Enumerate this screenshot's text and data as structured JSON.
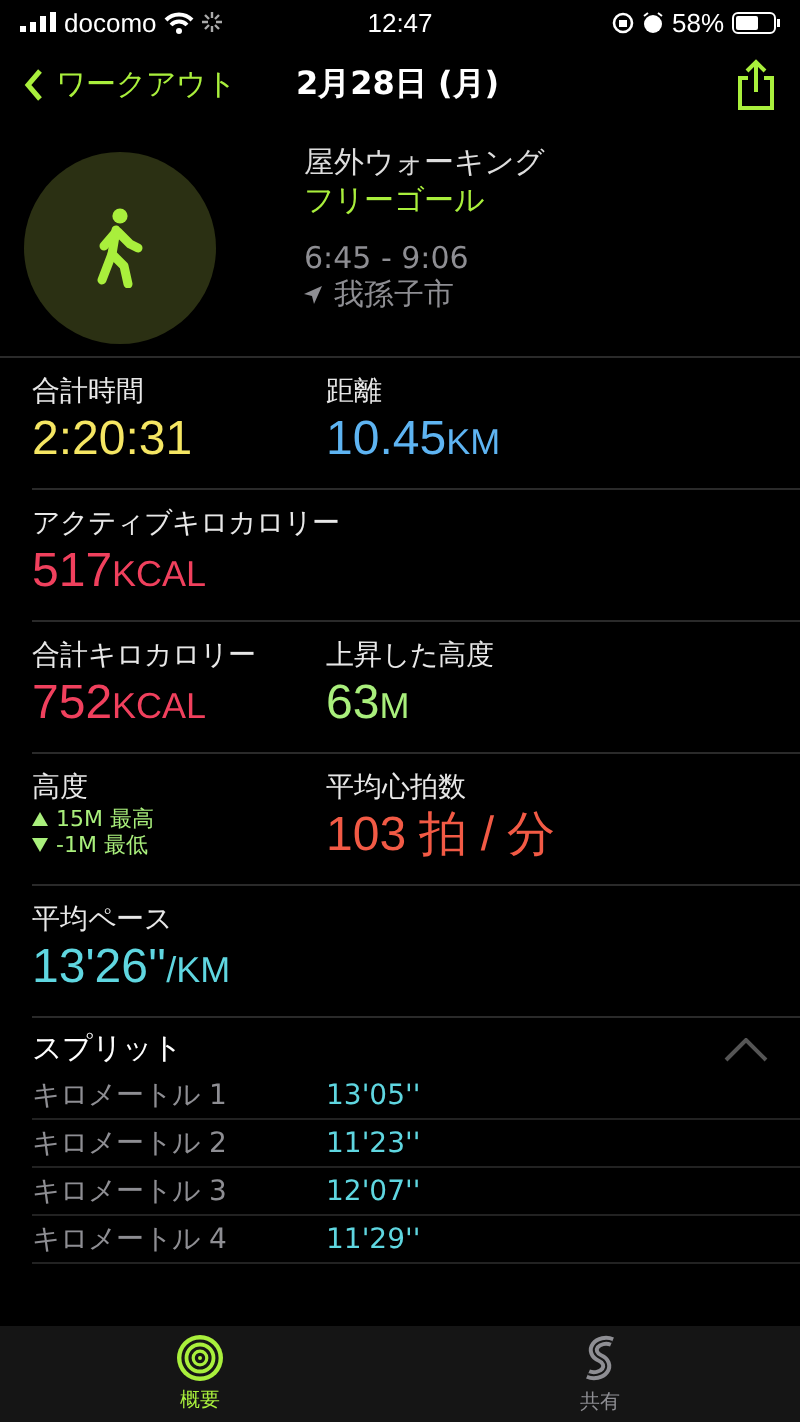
{
  "status_bar": {
    "carrier": "docomo",
    "time": "12:47",
    "battery": "58%"
  },
  "nav": {
    "back": "ワークアウト",
    "title": "2月28日 (月)"
  },
  "workout": {
    "type": "屋外ウォーキング",
    "goal": "フリーゴール",
    "time_range": "6:45 - 9:06",
    "location": "我孫子市"
  },
  "metric_rows": [
    [
      {
        "label": "合計時間",
        "value": "2:20:31",
        "color": "#f5e663"
      },
      {
        "label": "距離",
        "value": "10.45",
        "unit": "KM",
        "color": "#5eb4f2"
      }
    ],
    [
      {
        "label": "アクティブキロカロリー",
        "value": "517",
        "unit": "KCAL",
        "color": "#f0405d"
      }
    ],
    [
      {
        "label": "合計キロカロリー",
        "value": "752",
        "unit": "KCAL",
        "color": "#f0405d"
      },
      {
        "label": "上昇した高度",
        "value": "63",
        "unit": "M",
        "color": "#a9ef7c"
      }
    ],
    [
      {
        "label": "高度",
        "kind": "range",
        "high": "15M 最高",
        "low": "-1M 最低",
        "color": "#a9ef7c"
      },
      {
        "label": "平均心拍数",
        "value": "103 拍 / 分",
        "color": "#f25a45"
      }
    ],
    [
      {
        "label": "平均ペース",
        "value": "13'26''",
        "unit": "/KM",
        "color": "#5fd6e0"
      }
    ]
  ],
  "splits": {
    "title": "スプリット",
    "expanded": true,
    "rows": [
      {
        "label": "キロメートル 1",
        "value": "13'05''"
      },
      {
        "label": "キロメートル 2",
        "value": "11'23''"
      },
      {
        "label": "キロメートル 3",
        "value": "12'07''"
      },
      {
        "label": "キロメートル 4",
        "value": "11'29''"
      }
    ]
  },
  "tabs": [
    {
      "label": "概要",
      "selected": true
    },
    {
      "label": "共有",
      "selected": false
    }
  ]
}
